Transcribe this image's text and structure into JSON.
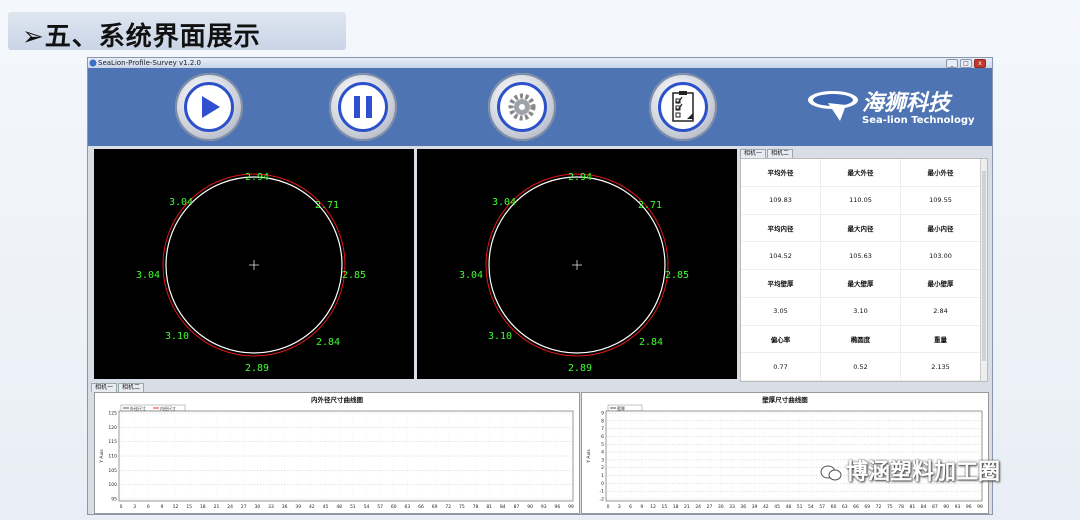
{
  "slide": {
    "title": "五、系统界面展示",
    "arrow": "➢"
  },
  "window": {
    "title": "SeaLion-Profile-Survey v1.2.0",
    "controls": [
      "_",
      "□",
      "x"
    ]
  },
  "toolbar": {
    "buttons": [
      {
        "name": "play-icon"
      },
      {
        "name": "pause-icon"
      },
      {
        "name": "gear-icon"
      },
      {
        "name": "checklist-icon"
      }
    ],
    "logo": {
      "cn": "海狮科技",
      "en": "Sea-lion Technology",
      "badge": "SEALION"
    }
  },
  "views": [
    {
      "top": "2.94",
      "top_right": "2.71",
      "right": "2.85",
      "bottom_right": "2.84",
      "bottom": "2.89",
      "bottom_left": "3.10",
      "left": "3.04",
      "top_left": "3.04"
    },
    {
      "top": "2.94",
      "top_right": "2.71",
      "right": "2.85",
      "bottom_right": "2.84",
      "bottom": "2.89",
      "bottom_left": "3.10",
      "left": "3.04",
      "top_left": "3.04"
    }
  ],
  "stats_tabs": [
    "相机一",
    "相机二"
  ],
  "stats": [
    {
      "label": "平均外径",
      "value": "109.83"
    },
    {
      "label": "最大外径",
      "value": "110.05"
    },
    {
      "label": "最小外径",
      "value": "109.55"
    },
    {
      "label": "平均内径",
      "value": "104.52"
    },
    {
      "label": "最大内径",
      "value": "105.63"
    },
    {
      "label": "最小内径",
      "value": "103.00"
    },
    {
      "label": "平均壁厚",
      "value": "3.05"
    },
    {
      "label": "最大壁厚",
      "value": "3.10"
    },
    {
      "label": "最小壁厚",
      "value": "2.84"
    },
    {
      "label": "偏心率",
      "value": "0.77"
    },
    {
      "label": "椭圆度",
      "value": "0.52"
    },
    {
      "label": "重量",
      "value": "2.135"
    }
  ],
  "bottom_tabs": [
    "相机一",
    "相机二"
  ],
  "charts": [
    {
      "title": "内外径尺寸曲线图",
      "legend": [
        "外径尺寸",
        "内径尺寸"
      ],
      "ylabel": "Y Axis",
      "y_ticks": [
        "125",
        "120",
        "115",
        "110",
        "105",
        "100",
        "95"
      ],
      "x_ticks": [
        "0",
        "3",
        "6",
        "9",
        "12",
        "15",
        "18",
        "21",
        "24",
        "27",
        "30",
        "33",
        "36",
        "39",
        "42",
        "45",
        "48",
        "51",
        "54",
        "57",
        "60",
        "63",
        "66",
        "69",
        "72",
        "75",
        "78",
        "81",
        "84",
        "87",
        "90",
        "93",
        "96",
        "99"
      ]
    },
    {
      "title": "壁厚尺寸曲线图",
      "legend": [
        "壁厚"
      ],
      "ylabel": "Y Axis",
      "y_ticks": [
        "9",
        "8",
        "7",
        "6",
        "5",
        "4",
        "3",
        "2",
        "1",
        "0",
        "-1",
        "-2"
      ],
      "x_ticks": [
        "0",
        "3",
        "6",
        "9",
        "12",
        "15",
        "18",
        "21",
        "24",
        "27",
        "30",
        "33",
        "36",
        "39",
        "42",
        "45",
        "48",
        "51",
        "54",
        "57",
        "60",
        "63",
        "66",
        "69",
        "72",
        "75",
        "78",
        "81",
        "84",
        "87",
        "90",
        "93",
        "96",
        "99"
      ]
    }
  ],
  "watermark": "博涵塑料加工圈"
}
